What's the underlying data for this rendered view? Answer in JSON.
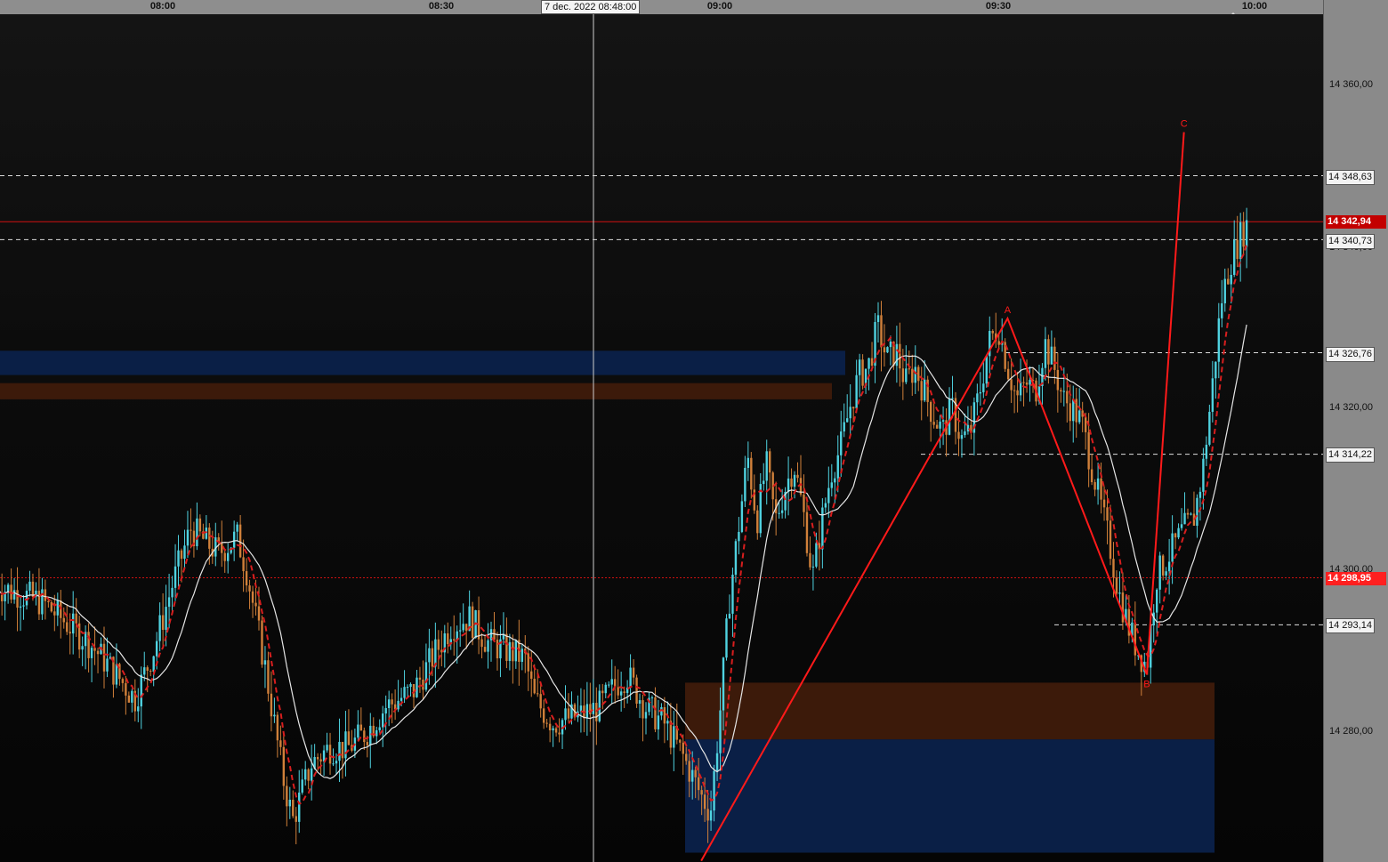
{
  "time_axis": {
    "labels": [
      "08:00",
      "08:30",
      "09:00",
      "09:30",
      "10:00"
    ],
    "crosshair_time": "7 dec. 2022 08:48:00"
  },
  "price_axis": {
    "ticks": [
      "14 360,00",
      "14 340,00",
      "14 320,00",
      "14 300,00",
      "14 280,00"
    ],
    "level_labels": {
      "l1": "14 348,63",
      "l2": "14 340,73",
      "l3": "14 326,76",
      "l4": "14 314,22",
      "l5": "14 293,14"
    },
    "current_price": "14 342,94",
    "marked_price": "14 298,95"
  },
  "colors": {
    "bull_candle": "#4fd2e0",
    "bear_candle": "#d0803a",
    "fast_ma": "#d81e1e",
    "slow_ma": "#e6e6e6",
    "pattern": "#ff1a1a",
    "supply_zone": "#3c1a0a",
    "demand_zone": "#0a1f46"
  },
  "chart_data": {
    "type": "candlestick",
    "instrument_session": "7 dec. 2022",
    "y_ticks": [
      14280,
      14300,
      14320,
      14340,
      14360
    ],
    "x_ticks": [
      "08:00",
      "08:30",
      "09:00",
      "09:30",
      "10:00"
    ],
    "horizontal_levels": [
      14348.63,
      14342.94,
      14340.73,
      14326.76,
      14314.22,
      14298.95,
      14293.14
    ],
    "pattern_points": [
      {
        "label": "A",
        "time": "09:31",
        "price": 14331
      },
      {
        "label": "B",
        "time": "09:46",
        "price": 14287
      },
      {
        "label": "C",
        "time": "09:50",
        "price": 14354
      }
    ],
    "pattern_start": {
      "time": "08:58",
      "price": 14264
    },
    "zones": [
      {
        "kind": "demand",
        "price_from": 14265,
        "price_to": 14279
      },
      {
        "kind": "supply",
        "price_from": 14279,
        "price_to": 14286
      },
      {
        "kind": "demand",
        "price_from": 14324,
        "price_to": 14327
      },
      {
        "kind": "supply",
        "price_from": 14321,
        "price_to": 14323
      }
    ],
    "close_path": [
      [
        "07:42",
        14298
      ],
      [
        "07:47",
        14296
      ],
      [
        "07:52",
        14291
      ],
      [
        "07:55",
        14287
      ],
      [
        "07:57",
        14284
      ],
      [
        "07:59",
        14290
      ],
      [
        "08:01",
        14298
      ],
      [
        "08:03",
        14305
      ],
      [
        "08:06",
        14302
      ],
      [
        "08:08",
        14304
      ],
      [
        "08:09",
        14300
      ],
      [
        "08:11",
        14288
      ],
      [
        "08:13",
        14274
      ],
      [
        "08:14",
        14269
      ],
      [
        "08:16",
        14276
      ],
      [
        "08:18",
        14278
      ],
      [
        "08:20",
        14278
      ],
      [
        "08:22",
        14280
      ],
      [
        "08:24",
        14283
      ],
      [
        "08:27",
        14285
      ],
      [
        "08:29",
        14289
      ],
      [
        "08:31",
        14293
      ],
      [
        "08:33",
        14294
      ],
      [
        "08:35",
        14291
      ],
      [
        "08:37",
        14290
      ],
      [
        "08:39",
        14289
      ],
      [
        "08:40",
        14284
      ],
      [
        "08:42",
        14281
      ],
      [
        "08:45",
        14282
      ],
      [
        "08:47",
        14283
      ],
      [
        "08:49",
        14286
      ],
      [
        "08:50",
        14287
      ],
      [
        "08:52",
        14283
      ],
      [
        "08:54",
        14281
      ],
      [
        "08:56",
        14277
      ],
      [
        "08:58",
        14272
      ],
      [
        "08:59",
        14270
      ],
      [
        "09:00",
        14282
      ],
      [
        "09:01",
        14296
      ],
      [
        "09:02",
        14305
      ],
      [
        "09:03",
        14314
      ],
      [
        "09:04",
        14306
      ],
      [
        "09:05",
        14313
      ],
      [
        "09:06",
        14306
      ],
      [
        "09:07",
        14310
      ],
      [
        "09:08",
        14313
      ],
      [
        "09:09",
        14307
      ],
      [
        "09:10",
        14299
      ],
      [
        "09:11",
        14306
      ],
      [
        "09:12",
        14312
      ],
      [
        "09:13",
        14315
      ],
      [
        "09:14",
        14320
      ],
      [
        "09:15",
        14324
      ],
      [
        "09:16",
        14325
      ],
      [
        "09:17",
        14330
      ],
      [
        "09:18",
        14326
      ],
      [
        "09:19",
        14327
      ],
      [
        "09:20",
        14323
      ],
      [
        "09:21",
        14325
      ],
      [
        "09:22",
        14322
      ],
      [
        "09:23",
        14319
      ],
      [
        "09:24",
        14317
      ],
      [
        "09:25",
        14320
      ],
      [
        "09:26",
        14316
      ],
      [
        "09:27",
        14317
      ],
      [
        "09:28",
        14322
      ],
      [
        "09:29",
        14328
      ],
      [
        "09:30",
        14330
      ],
      [
        "09:31",
        14325
      ],
      [
        "09:32",
        14321
      ],
      [
        "09:33",
        14323
      ],
      [
        "09:34",
        14322
      ],
      [
        "09:35",
        14328
      ],
      [
        "09:36",
        14325
      ],
      [
        "09:37",
        14321
      ],
      [
        "09:38",
        14320
      ],
      [
        "09:39",
        14318
      ],
      [
        "09:40",
        14313
      ],
      [
        "09:41",
        14308
      ],
      [
        "09:42",
        14303
      ],
      [
        "09:43",
        14297
      ],
      [
        "09:44",
        14293
      ],
      [
        "09:45",
        14290
      ],
      [
        "09:46",
        14288
      ],
      [
        "09:47",
        14299
      ],
      [
        "09:48",
        14301
      ],
      [
        "09:49",
        14303
      ],
      [
        "09:50",
        14305
      ],
      [
        "09:51",
        14306
      ],
      [
        "09:52",
        14312
      ],
      [
        "09:53",
        14322
      ],
      [
        "09:54",
        14333
      ],
      [
        "09:55",
        14338
      ],
      [
        "09:56",
        14341
      ],
      [
        "09:57",
        14343
      ]
    ]
  }
}
